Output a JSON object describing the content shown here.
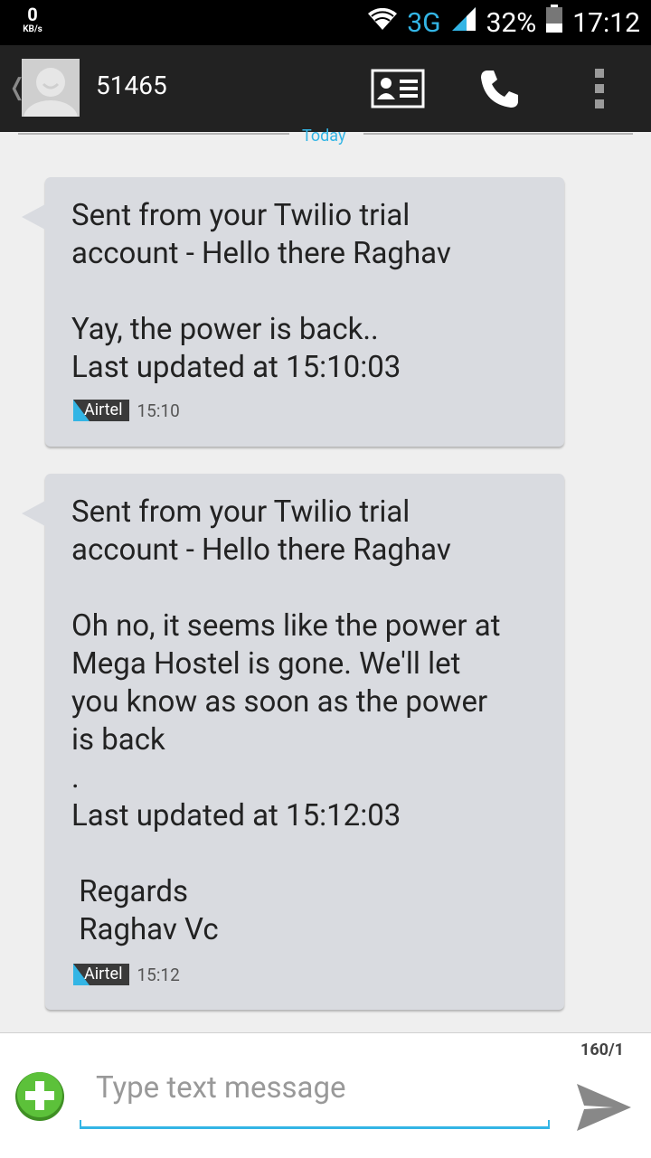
{
  "status_bar": {
    "net_speed_value": "0",
    "net_speed_unit": "KB/s",
    "network_type": "3G",
    "battery_percent": "32%",
    "time": "17:12",
    "icons": [
      "wifi-icon",
      "signal-icon",
      "battery-icon"
    ]
  },
  "header": {
    "contact_name": "51465",
    "icons": [
      "back-chevron-icon",
      "avatar-icon",
      "contact-card-icon",
      "phone-icon",
      "overflow-menu-icon"
    ]
  },
  "conversation": {
    "date_separator": "Today",
    "messages": [
      {
        "text": "Sent from your Twilio trial\naccount - Hello there Raghav\n\nYay, the power is back..\nLast updated at 15:10:03",
        "carrier": "Airtel",
        "time": "15:10"
      },
      {
        "text": "Sent from your Twilio trial\naccount - Hello there Raghav\n\nOh no, it seems like the power at\nMega Hostel is gone. We'll let\nyou know as soon as the power\nis back\n.\nLast updated at 15:12:03\n\n Regards\n Raghav Vc",
        "carrier": "Airtel",
        "time": "15:12"
      }
    ]
  },
  "compose": {
    "counter": "160/1",
    "placeholder": "Type text message",
    "value": "",
    "icons": [
      "add-attachment-icon",
      "send-icon"
    ]
  },
  "colors": {
    "accent": "#33b5e5",
    "bubble": "#d9dbe0",
    "action_bar": "#222222",
    "add_button": "#4caf2f"
  }
}
